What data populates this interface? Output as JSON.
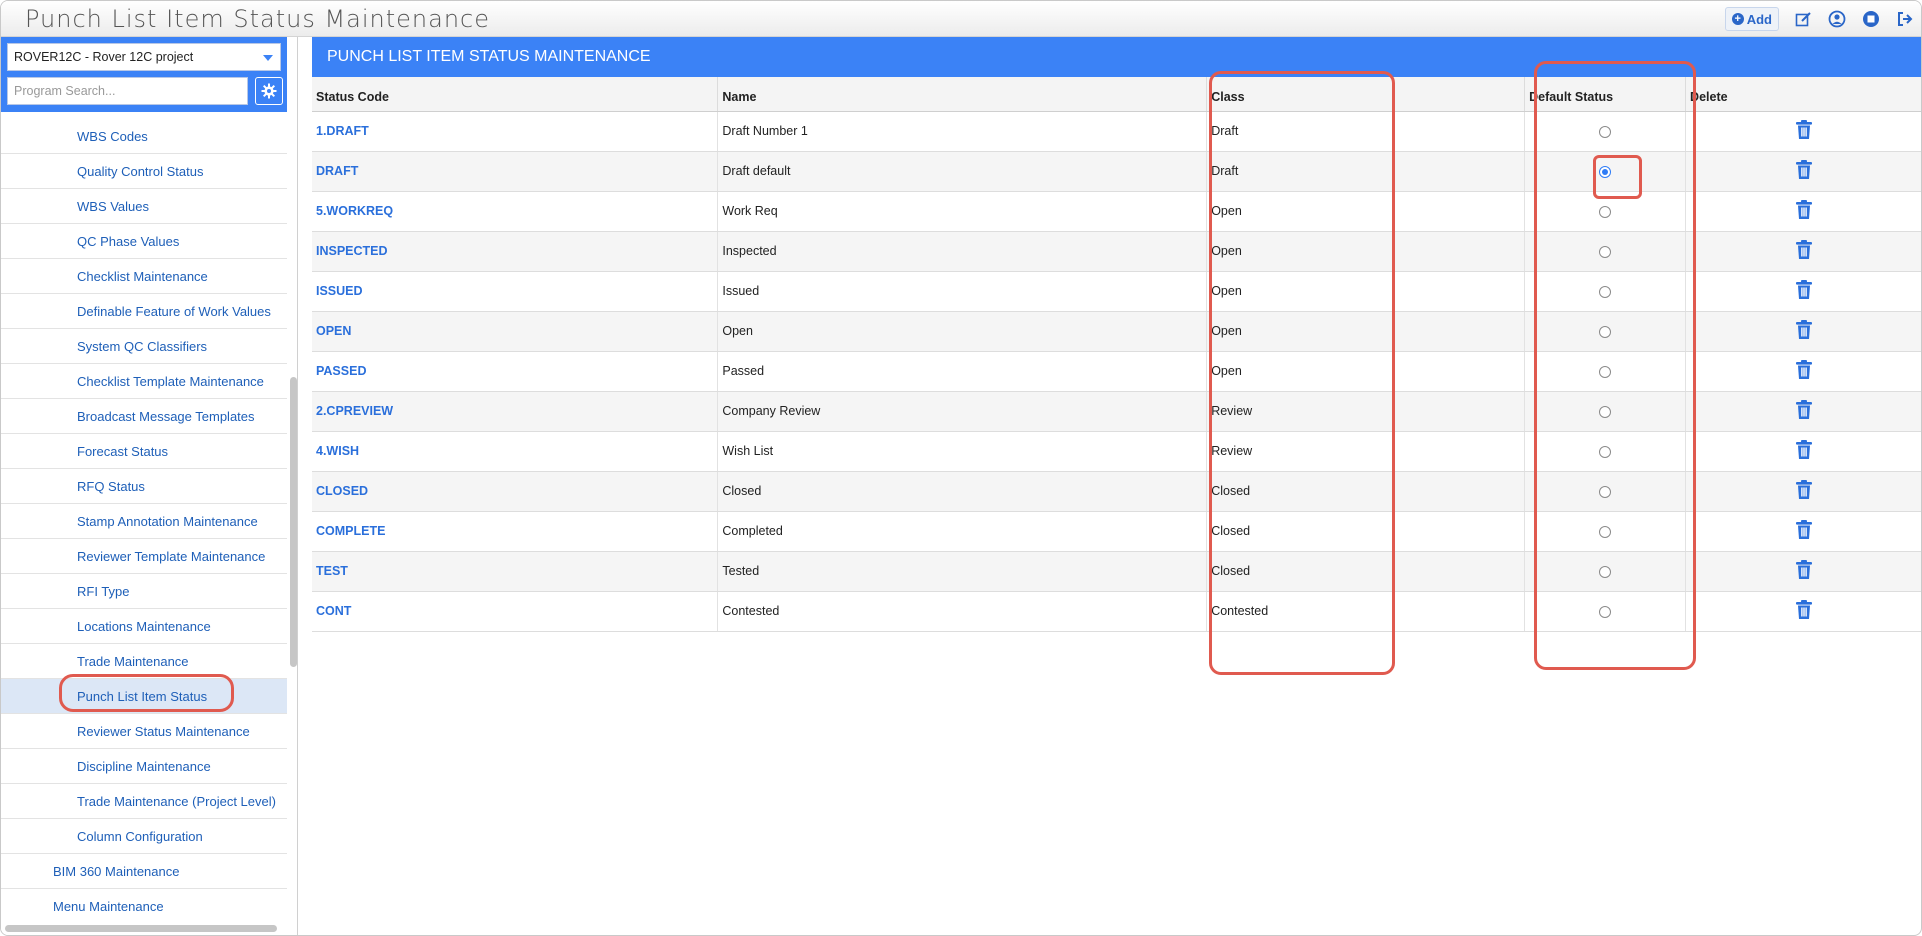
{
  "app": {
    "title": "Punch List Item Status Maintenance",
    "add_label": "Add"
  },
  "sidebar": {
    "project": "ROVER12C - Rover 12C project",
    "search_placeholder": "Program Search...",
    "items": [
      {
        "label": "WBS Codes"
      },
      {
        "label": "Quality Control Status"
      },
      {
        "label": "WBS Values"
      },
      {
        "label": "QC Phase Values"
      },
      {
        "label": "Checklist Maintenance"
      },
      {
        "label": "Definable Feature of Work Values"
      },
      {
        "label": "System QC Classifiers"
      },
      {
        "label": "Checklist Template Maintenance"
      },
      {
        "label": "Broadcast Message Templates"
      },
      {
        "label": "Forecast Status"
      },
      {
        "label": "RFQ Status"
      },
      {
        "label": "Stamp Annotation Maintenance"
      },
      {
        "label": "Reviewer Template Maintenance"
      },
      {
        "label": "RFI Type"
      },
      {
        "label": "Locations Maintenance"
      },
      {
        "label": "Trade Maintenance"
      },
      {
        "label": "Punch List Item Status",
        "active": true
      },
      {
        "label": "Reviewer Status Maintenance"
      },
      {
        "label": "Discipline Maintenance"
      },
      {
        "label": "Trade Maintenance (Project Level)"
      },
      {
        "label": "Column Configuration"
      },
      {
        "label": "BIM 360 Maintenance",
        "level": 1
      },
      {
        "label": "Menu Maintenance",
        "level": 1
      }
    ]
  },
  "main": {
    "panel_title": "PUNCH LIST ITEM STATUS MAINTENANCE",
    "columns": [
      "Status Code",
      "Name",
      "Class",
      "Default Status",
      "Delete"
    ],
    "rows": [
      {
        "code": "1.DRAFT",
        "name": "Draft Number 1",
        "class": "Draft",
        "default": false
      },
      {
        "code": "DRAFT",
        "name": "Draft default",
        "class": "Draft",
        "default": true
      },
      {
        "code": "5.WORKREQ",
        "name": "Work Req",
        "class": "Open",
        "default": false
      },
      {
        "code": "INSPECTED",
        "name": "Inspected",
        "class": "Open",
        "default": false
      },
      {
        "code": "ISSUED",
        "name": "Issued",
        "class": "Open",
        "default": false
      },
      {
        "code": "OPEN",
        "name": "Open",
        "class": "Open",
        "default": false
      },
      {
        "code": "PASSED",
        "name": "Passed",
        "class": "Open",
        "default": false
      },
      {
        "code": "2.CPREVIEW",
        "name": "Company Review",
        "class": "Review",
        "default": false
      },
      {
        "code": "4.WISH",
        "name": "Wish List",
        "class": "Review",
        "default": false
      },
      {
        "code": "CLOSED",
        "name": "Closed",
        "class": "Closed",
        "default": false
      },
      {
        "code": "COMPLETE",
        "name": "Completed",
        "class": "Closed",
        "default": false
      },
      {
        "code": "TEST",
        "name": "Tested",
        "class": "Closed",
        "default": false
      },
      {
        "code": "CONT",
        "name": "Contested",
        "class": "Contested",
        "default": false
      }
    ]
  },
  "colors": {
    "accent": "#3b82f6",
    "link": "#2a6fdb",
    "highlight": "#e05a4f"
  },
  "icons": {
    "add": "plus-circle-icon",
    "edit": "edit-icon",
    "user": "user-icon",
    "stop": "stop-icon",
    "logout": "logout-icon",
    "settings": "gear-icon",
    "delete": "trash-icon"
  }
}
